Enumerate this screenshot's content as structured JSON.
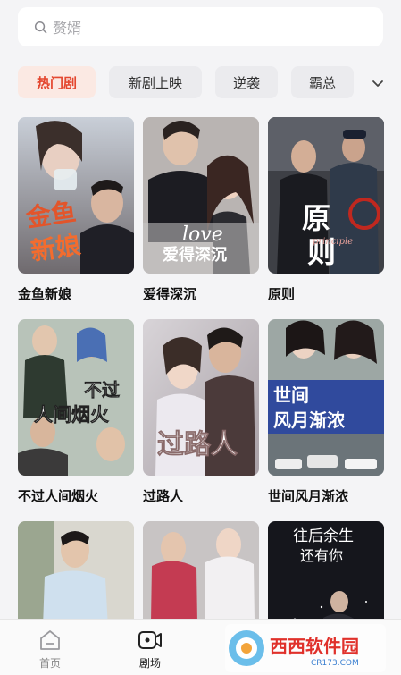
{
  "search": {
    "placeholder": "赘婿",
    "icon": "search-icon"
  },
  "categories": [
    {
      "label": "热门剧",
      "active": true
    },
    {
      "label": "新剧上映",
      "active": false
    },
    {
      "label": "逆袭",
      "active": false
    },
    {
      "label": "霸总",
      "active": false
    }
  ],
  "dramas": [
    {
      "title": "金鱼新娘",
      "poster_text": "金鱼新娘",
      "accent": "#e2552b"
    },
    {
      "title": "爱得深沉",
      "poster_text": "爱得深沉",
      "accent": "#d9d9d9"
    },
    {
      "title": "原则",
      "poster_text": "原则",
      "accent": "#ffffff"
    },
    {
      "title": "不过人间烟火",
      "poster_text": "不过人间烟火",
      "accent": "#ffffff"
    },
    {
      "title": "过路人",
      "poster_text": "过路人",
      "accent": "#ffffff"
    },
    {
      "title": "世间风月渐浓",
      "poster_text": "世间风月渐浓",
      "accent": "#1d3a9c"
    },
    {
      "title": "",
      "poster_text": "",
      "accent": "#7a93a8"
    },
    {
      "title": "",
      "poster_text": "",
      "accent": "#c43b52"
    },
    {
      "title": "",
      "poster_text": "往后余生 还有你",
      "accent": "#ffffff"
    }
  ],
  "nav": [
    {
      "label": "首页",
      "icon": "home-icon",
      "active": false
    },
    {
      "label": "剧场",
      "icon": "theater-icon",
      "active": true
    }
  ],
  "watermark": {
    "text": "西西软件园",
    "sub": "CR173.COM"
  }
}
